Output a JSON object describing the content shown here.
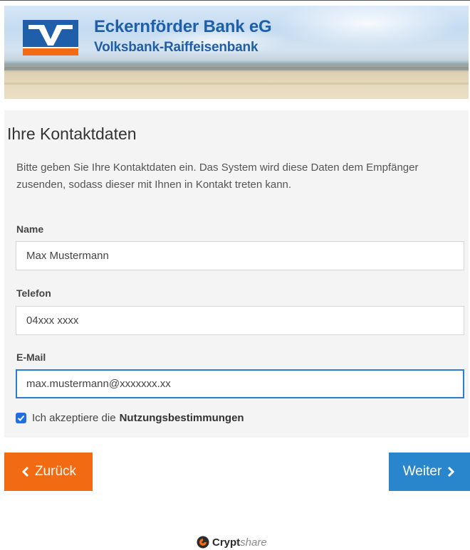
{
  "brand": {
    "title": "Eckernförder Bank eG",
    "subtitle": "Volksbank-Raiffeisenbank",
    "logo_icon": "vr-logo-icon"
  },
  "page": {
    "title": "Ihre Kontaktdaten",
    "intro": "Bitte geben Sie Ihre Kontaktdaten ein. Das System wird diese Daten dem Empfänger zusenden, sodass dieser mit Ihnen in Kontakt treten kann."
  },
  "form": {
    "name": {
      "label": "Name",
      "value": "Max Mustermann"
    },
    "phone": {
      "label": "Telefon",
      "value": "04xxx xxxx"
    },
    "email": {
      "label": "E-Mail",
      "value": "max.mustermann@xxxxxxx.xx"
    },
    "terms": {
      "prefix": "Ich akzeptiere die",
      "link": "Nutzungsbestimmungen",
      "checked": true
    }
  },
  "buttons": {
    "back": "Zurück",
    "next": "Weiter"
  },
  "footer": {
    "brand_strong": "Crypt",
    "brand_light": "share"
  },
  "colors": {
    "brand_blue": "#1f5ea8",
    "logo_orange": "#f26a12",
    "back_button": "#f26a12",
    "next_button": "#2986cc",
    "focus_border": "#2a7ecf"
  }
}
